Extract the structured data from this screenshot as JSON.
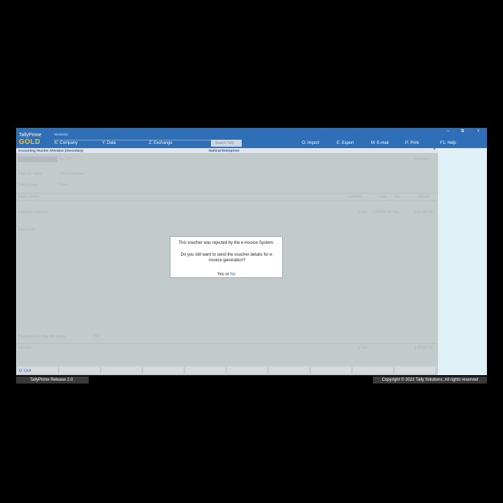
{
  "app": {
    "brand_name": "TallyPrime",
    "edition": "GOLD",
    "manage_label": "MANAGE"
  },
  "menu": {
    "company": "K: Company",
    "data": "Y: Data",
    "exchange": "Z: Exchange",
    "search_placeholder": "Search Tally",
    "import": "O: Import",
    "export": "E: Export",
    "email": "M: E-mail",
    "print": "P: Print",
    "help": "F1: Help"
  },
  "window": {
    "minimize": "–",
    "restore": "⧉",
    "close": "×"
  },
  "screen": {
    "title": "Accounting Voucher Alteration (Secondary)",
    "company_name": "National Enterprises",
    "close": "×"
  },
  "form": {
    "voucher_no": "No. 172",
    "party_label": "Party A/c name",
    "party_value": "TTS Enterprises",
    "sales_label": "Sales ledger",
    "sales_value": "Sales",
    "name_of_item": "Name of Item",
    "quantity": "Quantity",
    "rate": "Rate",
    "per": "per",
    "amount": "Amount",
    "item_name": "Industrial Cylinders",
    "item_qty": "1 Nos",
    "item_rate": "1,00,000.00 / Nos",
    "item_amount": "1,00,000.00",
    "end_of_list": "End of List",
    "day": "Saturday",
    "provide_details": "Provide GST/e-Way Bill details",
    "provide_value": "No",
    "narration": "Narration:",
    "total_qty": "1 Nos",
    "total_amount": "1,00,000.00"
  },
  "bottom": {
    "quit": "Q: Quit"
  },
  "dialog": {
    "message": "This voucher was rejected by the e-Invoice System.",
    "question": "Do you still want to send the voucher details for e-Invoice generation?",
    "yes": "Yes",
    "or": "or",
    "no": "No"
  },
  "footer": {
    "release": "TallyPrime Release 2.0",
    "copyright": "Copyright © 2022 Tally Solutions, All rights reserved"
  },
  "colors": {
    "topbar": "#2e6fb8",
    "edition": "#f1c232",
    "right_panel": "#dff0f7"
  }
}
